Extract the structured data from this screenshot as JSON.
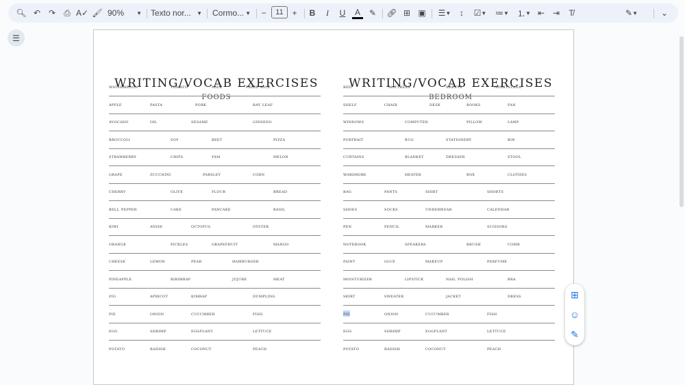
{
  "toolbar": {
    "zoom": "90%",
    "style": "Texto nor...",
    "font": "Cormo...",
    "font_size": "11",
    "bold": "B",
    "italic": "I",
    "underline": "U",
    "text_color": "A",
    "minus": "−",
    "plus": "+"
  },
  "left": {
    "title": "WRITING/VOCAB EXERCISES",
    "subtitle": "FOODS",
    "rows": [
      [
        "watermelon",
        "tomato",
        "milk",
        "fried rice"
      ],
      [
        "apple",
        "pasta",
        "pork",
        "bay leaf"
      ],
      [
        "avocado",
        "oil",
        "sesame",
        "ginseng"
      ],
      [
        "broccoli",
        "soy",
        "beet",
        "pizza"
      ],
      [
        "strawberry",
        "chips",
        "yam",
        "melon"
      ],
      [
        "grape",
        "zucchini",
        "parsley",
        "corn"
      ],
      [
        "cherry",
        "olive",
        "flour",
        "bread"
      ],
      [
        "bell pepper",
        "cake",
        "pancake",
        "basil"
      ],
      [
        "kiwi",
        "anise",
        "octopus",
        "oyster"
      ],
      [
        "orange",
        "pickles",
        "grapefruit",
        "mango"
      ],
      [
        "cheese",
        "lemon",
        "pear",
        "hamburger"
      ],
      [
        "pineapple",
        "bibimbap",
        "jujube",
        "meat"
      ],
      [
        "fig",
        "apricot",
        "kimbap",
        "dumpling"
      ],
      [
        "pie",
        "onion",
        "cucumber",
        "fish"
      ],
      [
        "egg",
        "shrimp",
        "eggplant",
        "lettuce"
      ],
      [
        "potato",
        "radish",
        "coconut",
        "peach"
      ]
    ]
  },
  "right": {
    "title": "WRITING/VOCAB EXERCISES",
    "subtitle": "BEDROOM",
    "rows": [
      [
        "bed",
        "mattress",
        "sheets",
        "nightstand"
      ],
      [
        "shelf",
        "chair",
        "desk",
        "books",
        "fan"
      ],
      [
        "windows",
        "computer",
        "pillow",
        "lamp"
      ],
      [
        "portrait",
        "rug",
        "stationery",
        "bin"
      ],
      [
        "curtains",
        "blanket",
        "dresser",
        "stool"
      ],
      [
        "wardrobe",
        "heater",
        "box",
        "clothes"
      ],
      [
        "bag",
        "pants",
        "shirt",
        "shorts"
      ],
      [
        "shoes",
        "socks",
        "underwear",
        "calendar"
      ],
      [
        "pen",
        "pencil",
        "marker",
        "scissors"
      ],
      [
        "notebook",
        "speakers",
        "brush",
        "comb"
      ],
      [
        "paint",
        "glue",
        "makeup",
        "perfume"
      ],
      [
        "moisturizer",
        "lipstick",
        "nail polish",
        "bra"
      ],
      [
        "skirt",
        "sweater",
        "jacket",
        "dress"
      ],
      [
        "pie",
        "onion",
        "cucumber",
        "fish"
      ],
      [
        "egg",
        "shrimp",
        "eggplant",
        "lettuce"
      ],
      [
        "potato",
        "radish",
        "coconut",
        "peach"
      ]
    ]
  }
}
